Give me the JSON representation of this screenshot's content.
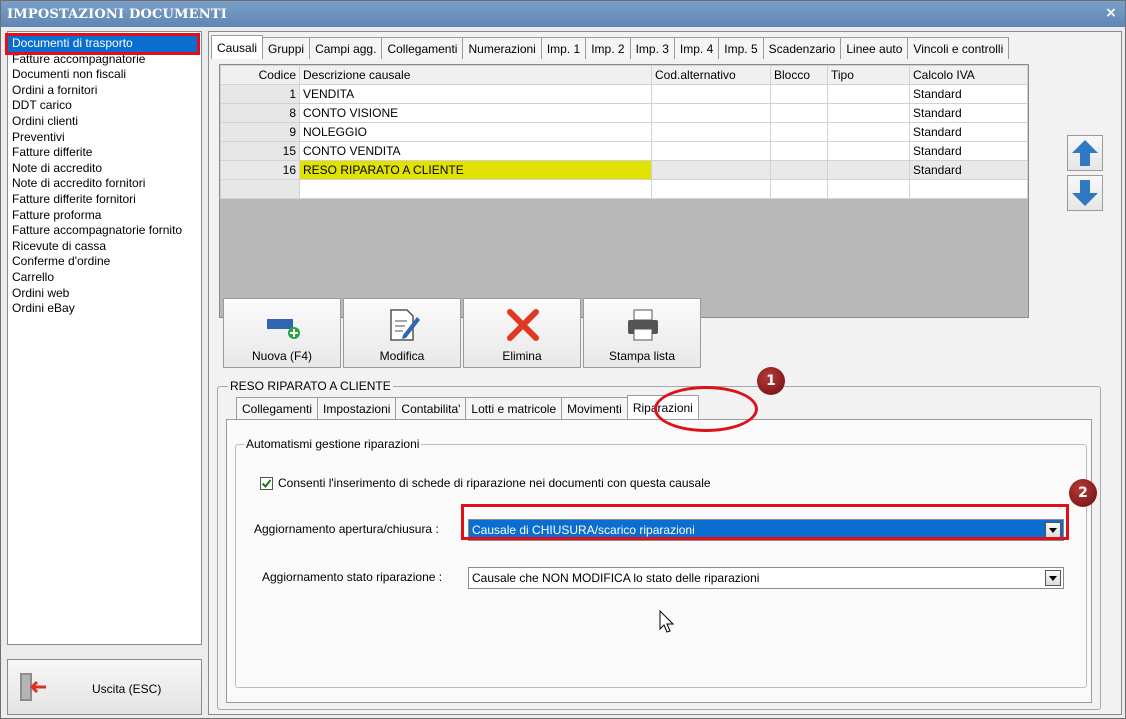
{
  "window": {
    "title": "IMPOSTAZIONI DOCUMENTI",
    "close_glyph": "×"
  },
  "doc_types": [
    "Documenti di trasporto",
    "Fatture accompagnatorie",
    "Documenti non fiscali",
    "Ordini a fornitori",
    "DDT carico",
    "Ordini clienti",
    "Preventivi",
    "Fatture differite",
    "Note di accredito",
    "Note di accredito fornitori",
    "Fatture differite fornitori",
    "Fatture proforma",
    "Fatture accompagnatorie fornito",
    "Ricevute di cassa",
    "Conferme d'ordine",
    "Carrello",
    "Ordini web",
    "Ordini eBay"
  ],
  "exit_button": {
    "label": "Uscita (ESC)",
    "icon": "exit-door-icon"
  },
  "top_tabs": [
    "Causali",
    "Gruppi",
    "Campi agg.",
    "Collegamenti",
    "Numerazioni",
    "Imp. 1",
    "Imp. 2",
    "Imp. 3",
    "Imp. 4",
    "Imp. 5",
    "Scadenzario",
    "Linee auto",
    "Vincoli e controlli"
  ],
  "grid": {
    "headers": [
      "Codice",
      "Descrizione causale",
      "Cod.alternativo",
      "Blocco",
      "Tipo",
      "Calcolo IVA"
    ],
    "rows": [
      [
        "1",
        "VENDITA",
        "",
        "",
        "",
        "Standard"
      ],
      [
        "8",
        "CONTO VISIONE",
        "",
        "",
        "",
        "Standard"
      ],
      [
        "9",
        "NOLEGGIO",
        "",
        "",
        "",
        "Standard"
      ],
      [
        "15",
        "CONTO VENDITA",
        "",
        "",
        "",
        "Standard"
      ],
      [
        "16",
        "RESO RIPARATO A CLIENTE",
        "",
        "",
        "",
        "Standard"
      ],
      [
        "",
        "",
        "",
        "",
        "",
        ""
      ]
    ]
  },
  "toolbar": {
    "new_label": "Nuova (F4)",
    "edit_label": "Modifica",
    "delete_label": "Elimina",
    "print_label": "Stampa lista"
  },
  "detail": {
    "group_title": "RESO RIPARATO A CLIENTE",
    "subtabs": [
      "Collegamenti",
      "Impostazioni",
      "Contabilita'",
      "Lotti e matricole",
      "Movimenti",
      "Riparazioni"
    ],
    "inner_group": "Automatismi gestione riparazioni",
    "checkbox_label": "Consenti l'inserimento di schede di riparazione nei documenti con questa causale",
    "checkbox_checked": true,
    "field1_label": "Aggiornamento apertura/chiusura :",
    "field1_value": "Causale di CHIUSURA/scarico riparazioni",
    "field2_label": "Aggiornamento stato riparazione :",
    "field2_value": "Causale che NON MODIFICA lo stato delle riparazioni"
  },
  "callouts": {
    "one": "1",
    "two": "2"
  },
  "colors": {
    "highlight_yellow": "#e2e200",
    "selection_blue": "#0a6ed1",
    "callout_red": "#e0101a"
  }
}
